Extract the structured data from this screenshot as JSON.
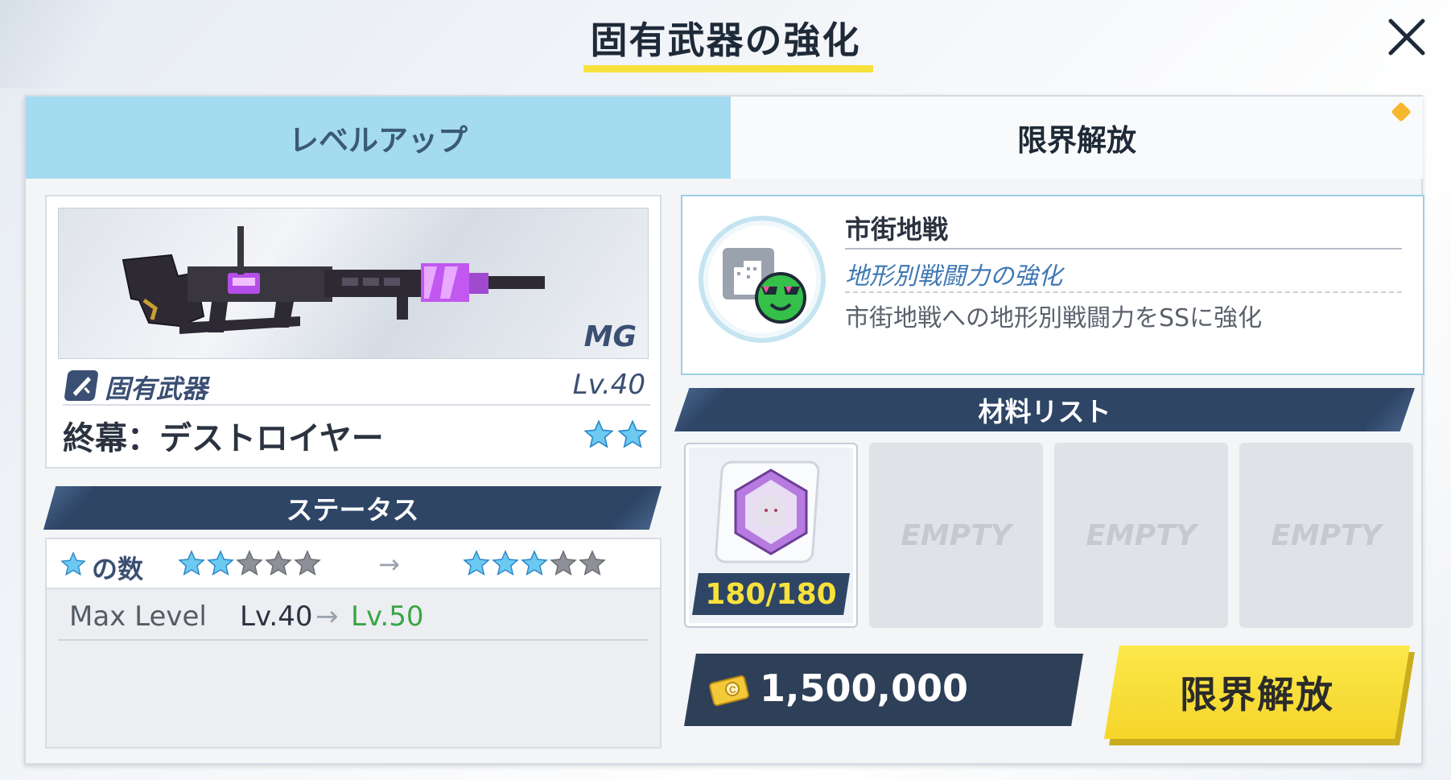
{
  "header": {
    "title": "固有武器の強化",
    "close_icon": "close-icon"
  },
  "tabs": [
    {
      "label": "レベルアップ",
      "active": false
    },
    {
      "label": "限界解放",
      "active": true
    }
  ],
  "weapon": {
    "class": "MG",
    "type_label": "固有武器",
    "level": "Lv.40",
    "name": "終幕：デストロイヤー",
    "stars": 2
  },
  "status": {
    "header": "ステータス",
    "star_label": "の数",
    "stars_from": 2,
    "stars_to": 3,
    "stars_max": 5,
    "max_level_label": "Max Level",
    "max_level_from": "Lv.40",
    "max_level_to": "Lv.50"
  },
  "ability": {
    "name": "市街地戦",
    "subtitle": "地形別戦闘力の強化",
    "description": "市街地戦への地形別戦闘力をSSに強化"
  },
  "materials": {
    "header": "材料リスト",
    "slots": [
      {
        "filled": true,
        "count": "180/180"
      },
      {
        "filled": false,
        "label": "EMPTY"
      },
      {
        "filled": false,
        "label": "EMPTY"
      },
      {
        "filled": false,
        "label": "EMPTY"
      }
    ]
  },
  "cost": {
    "value": "1,500,000",
    "icon": "credit-icon"
  },
  "action": {
    "label": "限界解放"
  },
  "colors": {
    "accent_yellow": "#f7e23c",
    "navy": "#2e4566",
    "tab_blue": "#a5dbf0",
    "level_green": "#3aa545"
  }
}
